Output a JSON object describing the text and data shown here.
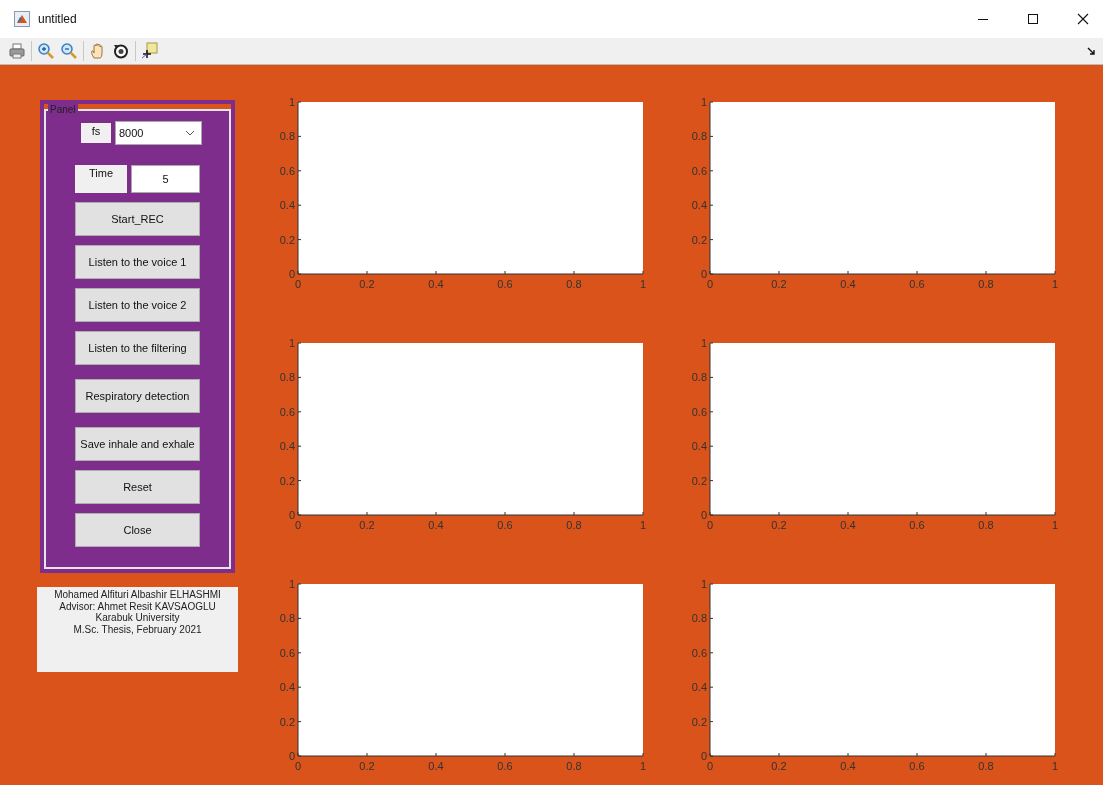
{
  "window": {
    "title": "untitled"
  },
  "panel": {
    "title": "Panel",
    "fs_label": "fs",
    "fs_dropdown": {
      "value": "8000"
    },
    "time_label": "Time",
    "time_field": {
      "value": "5"
    },
    "buttons": [
      "Start_REC",
      "Listen to the voice 1",
      "Listen to the voice 2",
      "Listen to the filtering",
      "Respiratory detection",
      "Save inhale and exhale",
      "Reset",
      "Close"
    ]
  },
  "info_lines": [
    "Mohamed Alfituri Albashir ELHASHMI",
    "Advisor: Ahmet Resit KAVSAOGLU",
    "Karabuk University",
    "M.Sc. Thesis, February 2021"
  ],
  "axes": [
    {
      "chart_data": {
        "type": "line",
        "xlim": [
          0,
          1
        ],
        "ylim": [
          0,
          1
        ],
        "xticks": [
          0,
          0.2,
          0.4,
          0.6,
          0.8,
          1
        ],
        "yticks": [
          0,
          0.2,
          0.4,
          0.6,
          0.8,
          1
        ]
      }
    },
    {
      "chart_data": {
        "type": "line",
        "xlim": [
          0,
          1
        ],
        "ylim": [
          0,
          1
        ],
        "xticks": [
          0,
          0.2,
          0.4,
          0.6,
          0.8,
          1
        ],
        "yticks": [
          0,
          0.2,
          0.4,
          0.6,
          0.8,
          1
        ]
      }
    },
    {
      "chart_data": {
        "type": "line",
        "xlim": [
          0,
          1
        ],
        "ylim": [
          0,
          1
        ],
        "xticks": [
          0,
          0.2,
          0.4,
          0.6,
          0.8,
          1
        ],
        "yticks": [
          0,
          0.2,
          0.4,
          0.6,
          0.8,
          1
        ]
      }
    },
    {
      "chart_data": {
        "type": "line",
        "xlim": [
          0,
          1
        ],
        "ylim": [
          0,
          1
        ],
        "xticks": [
          0,
          0.2,
          0.4,
          0.6,
          0.8,
          1
        ],
        "yticks": [
          0,
          0.2,
          0.4,
          0.6,
          0.8,
          1
        ]
      }
    },
    {
      "chart_data": {
        "type": "line",
        "xlim": [
          0,
          1
        ],
        "ylim": [
          0,
          1
        ],
        "xticks": [
          0,
          0.2,
          0.4,
          0.6,
          0.8,
          1
        ],
        "yticks": [
          0,
          0.2,
          0.4,
          0.6,
          0.8,
          1
        ]
      }
    },
    {
      "chart_data": {
        "type": "line",
        "xlim": [
          0,
          1
        ],
        "ylim": [
          0,
          1
        ],
        "xticks": [
          0,
          0.2,
          0.4,
          0.6,
          0.8,
          1
        ],
        "yticks": [
          0,
          0.2,
          0.4,
          0.6,
          0.8,
          1
        ]
      }
    }
  ]
}
